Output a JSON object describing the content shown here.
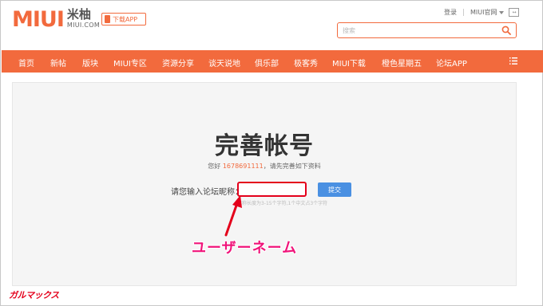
{
  "header": {
    "logo_text": "MIUI",
    "logo_cn": "米柚",
    "logo_domain": "MIUI.COM",
    "download_label": "下载APP",
    "login_label": "登录",
    "official_site_label": "MIUI官网",
    "search_placeholder": "搜索"
  },
  "nav": {
    "items": [
      {
        "label": "首页"
      },
      {
        "label": "新帖"
      },
      {
        "label": "版块"
      },
      {
        "label": "MIUI专区"
      },
      {
        "label": "资源分享"
      },
      {
        "label": "谈天说地"
      },
      {
        "label": "俱乐部"
      },
      {
        "label": "极客秀"
      },
      {
        "label": "MIUI下载"
      },
      {
        "label": "橙色星期五"
      },
      {
        "label": "论坛APP"
      }
    ],
    "menu_icon": "hamburger-menu-icon"
  },
  "main": {
    "title": "完善帐号",
    "greeting_prefix": "您好",
    "phone_number": "1678691111",
    "greeting_suffix": "，请先完善如下资料",
    "nickname_label": "请您输入论坛昵称：",
    "nickname_value": "",
    "submit_label": "提交",
    "hint": "昵称长度为3-15个字符,1个中文占3个字符"
  },
  "annotation": {
    "text": "ユーザーネーム"
  },
  "watermark": {
    "text": "ガルマックス"
  },
  "colors": {
    "brand": "#f26a3d",
    "submit": "#4a90e2",
    "highlight": "#e4001b",
    "annotation": "#f0147a"
  }
}
